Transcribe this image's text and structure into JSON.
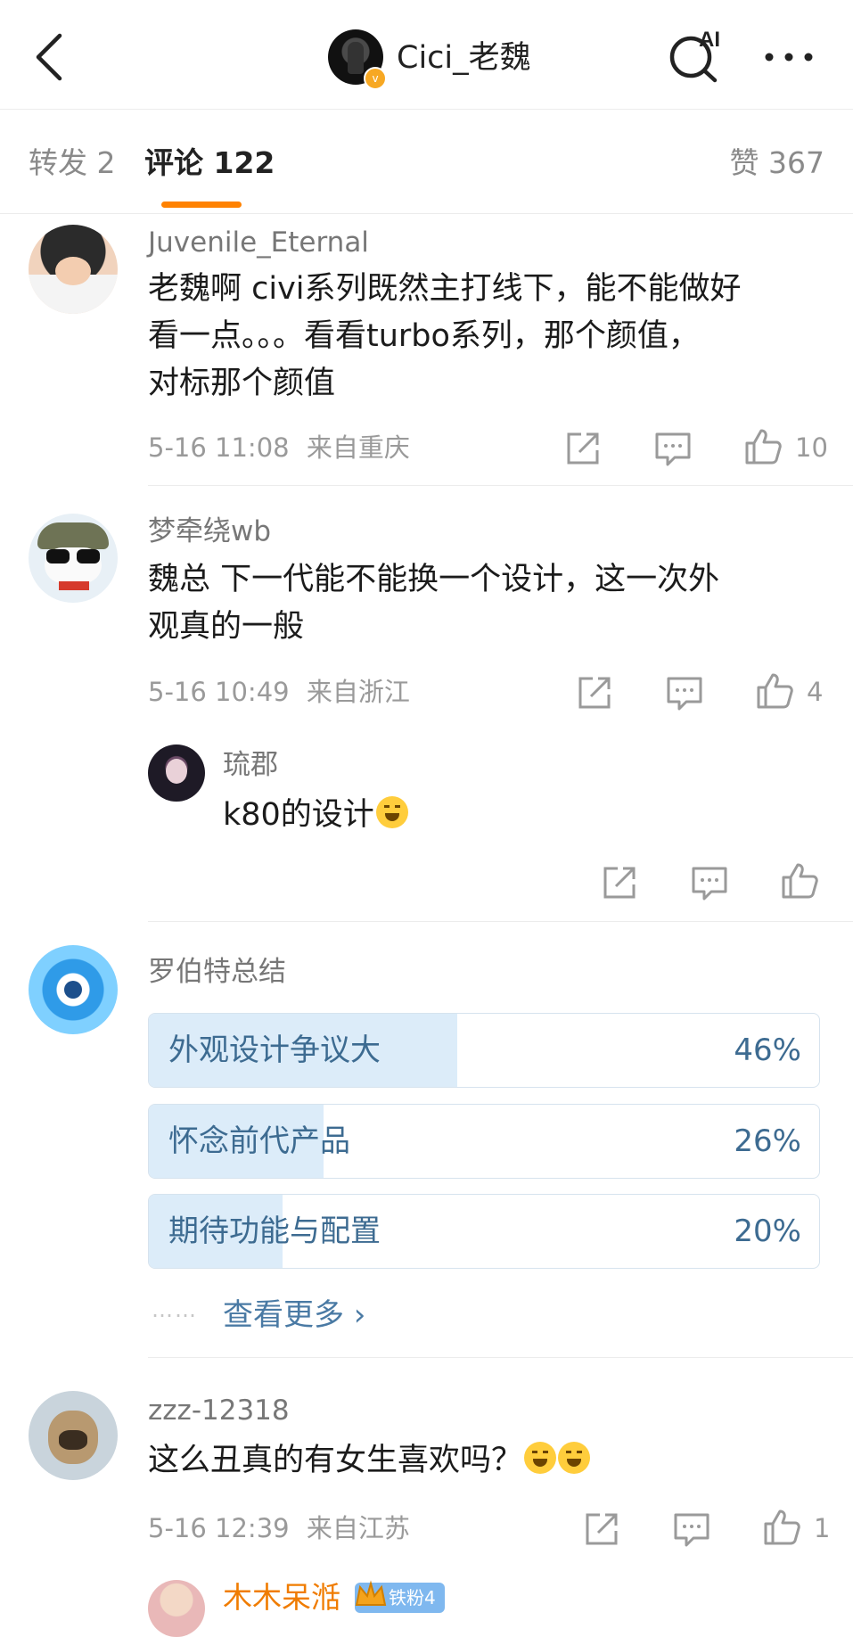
{
  "header": {
    "title": "Cici_老魏",
    "ai_label": "AI"
  },
  "tabs": {
    "repost": "转发 2",
    "comments": "评论 122",
    "likes": "赞 367"
  },
  "comments": [
    {
      "username": "Juvenile_Eternal",
      "text_lines": [
        "老魏啊 civi系列既然主打线下，能不能做好",
        "看一点。。。看看turbo系列，那个颜值，",
        "对标那个颜值"
      ],
      "time": "5-16 11:08",
      "location": "来自重庆",
      "likes": "10"
    },
    {
      "username": "梦牵绕wb",
      "text_lines": [
        "魏总 下一代能不能换一个设计，这一次外",
        "观真的一般"
      ],
      "time": "5-16 10:49",
      "location": "来自浙江",
      "likes": "4"
    },
    {
      "username": "zzz-12318",
      "text_lines": [
        "这么丑真的有女生喜欢吗？"
      ],
      "time": "5-16 12:39",
      "location": "来自江苏",
      "likes": "1"
    }
  ],
  "reply": {
    "username": "琉郡",
    "text": "k80的设计"
  },
  "summary": {
    "author": "罗伯特总结",
    "options": [
      {
        "label": "外观设计争议大",
        "percent": "46%",
        "value": 0.46
      },
      {
        "label": "怀念前代产品",
        "percent": "26%",
        "value": 0.26
      },
      {
        "label": "期待功能与配置",
        "percent": "20%",
        "value": 0.2
      }
    ],
    "see_more": "查看更多 ›",
    "dots": "……"
  },
  "last_user": {
    "username": "木木呆湉",
    "badge": "铁粉4"
  },
  "colors": {
    "accent": "#ff8200",
    "link": "#4a7aa4",
    "poll_fill": "#dcecf9",
    "fan_name": "#f07c00"
  },
  "icons": [
    "back-icon",
    "verified-icon",
    "ai-search-icon",
    "more-icon",
    "share-icon",
    "comment-icon",
    "like-icon",
    "laugh-cry-emoji",
    "crown-icon"
  ]
}
